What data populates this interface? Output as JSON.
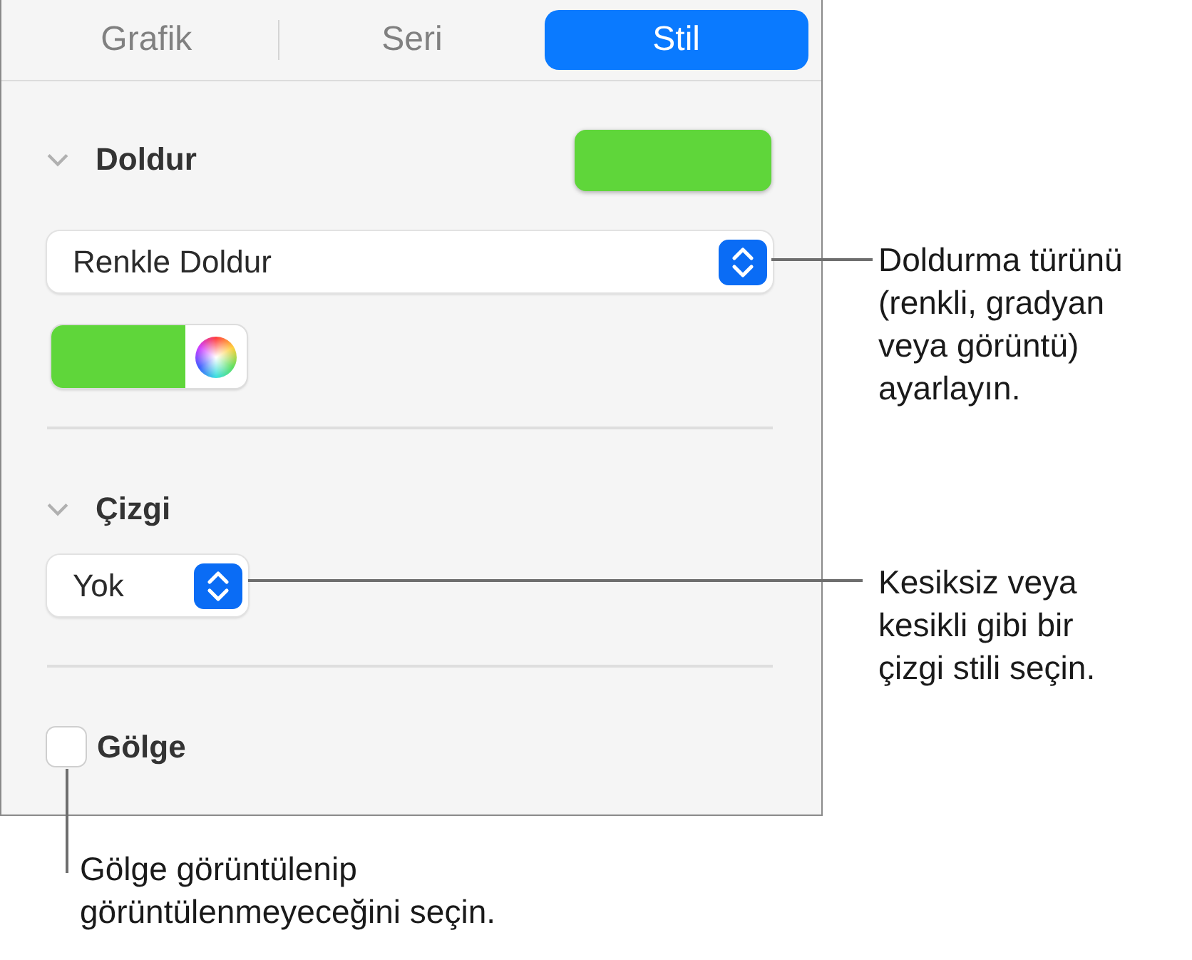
{
  "tabs": [
    {
      "label": "Grafik",
      "selected": false
    },
    {
      "label": "Seri",
      "selected": false
    },
    {
      "label": "Stil",
      "selected": true
    }
  ],
  "fill": {
    "title": "Doldur",
    "expanded": true,
    "color": "#5fd63a",
    "type": "Renkle Doldur"
  },
  "stroke": {
    "title": "Çizgi",
    "expanded": true,
    "value": "Yok"
  },
  "shadow": {
    "label": "Gölge",
    "checked": false
  },
  "callouts": [
    {
      "lines": [
        "Doldurma türünü",
        "(renkli, gradyan",
        "veya görüntü)",
        "ayarlayın."
      ]
    },
    {
      "lines": [
        "Kesiksiz veya",
        "kesikli gibi bir",
        "çizgi stili seçin."
      ]
    },
    {
      "lines": [
        "Gölge görüntülenip",
        "görüntülenmeyeceğini seçin."
      ]
    }
  ]
}
